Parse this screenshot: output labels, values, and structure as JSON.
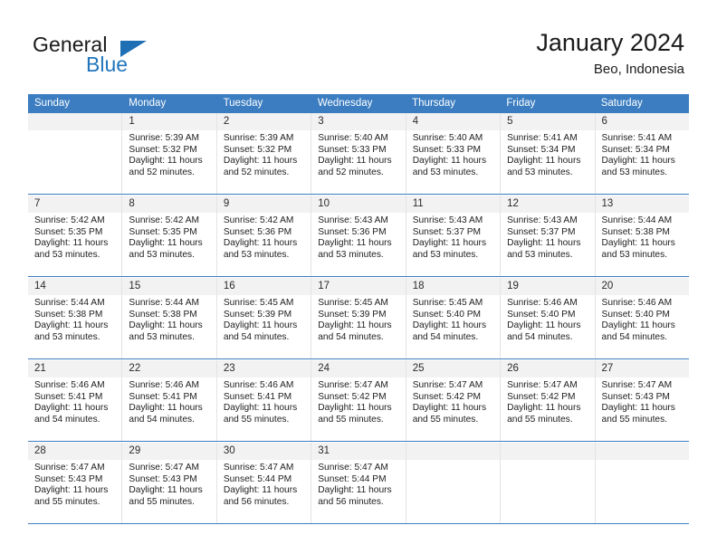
{
  "brand": {
    "name_part1": "General",
    "name_part2": "Blue",
    "triangle_icon": "triangle-icon",
    "accent_color": "#2176bd"
  },
  "header": {
    "title": "January 2024",
    "location": "Beo, Indonesia"
  },
  "calendar": {
    "header_color": "#3b7dc0",
    "daynum_bg": "#f2f2f2",
    "weekday_headers": [
      "Sunday",
      "Monday",
      "Tuesday",
      "Wednesday",
      "Thursday",
      "Friday",
      "Saturday"
    ],
    "weeks": [
      [
        {
          "day": "",
          "sunrise": "",
          "sunset": "",
          "daylight1": "",
          "daylight2": "",
          "empty": true
        },
        {
          "day": "1",
          "sunrise": "Sunrise: 5:39 AM",
          "sunset": "Sunset: 5:32 PM",
          "daylight1": "Daylight: 11 hours",
          "daylight2": "and 52 minutes.",
          "empty": false
        },
        {
          "day": "2",
          "sunrise": "Sunrise: 5:39 AM",
          "sunset": "Sunset: 5:32 PM",
          "daylight1": "Daylight: 11 hours",
          "daylight2": "and 52 minutes.",
          "empty": false
        },
        {
          "day": "3",
          "sunrise": "Sunrise: 5:40 AM",
          "sunset": "Sunset: 5:33 PM",
          "daylight1": "Daylight: 11 hours",
          "daylight2": "and 52 minutes.",
          "empty": false
        },
        {
          "day": "4",
          "sunrise": "Sunrise: 5:40 AM",
          "sunset": "Sunset: 5:33 PM",
          "daylight1": "Daylight: 11 hours",
          "daylight2": "and 53 minutes.",
          "empty": false
        },
        {
          "day": "5",
          "sunrise": "Sunrise: 5:41 AM",
          "sunset": "Sunset: 5:34 PM",
          "daylight1": "Daylight: 11 hours",
          "daylight2": "and 53 minutes.",
          "empty": false
        },
        {
          "day": "6",
          "sunrise": "Sunrise: 5:41 AM",
          "sunset": "Sunset: 5:34 PM",
          "daylight1": "Daylight: 11 hours",
          "daylight2": "and 53 minutes.",
          "empty": false
        }
      ],
      [
        {
          "day": "7",
          "sunrise": "Sunrise: 5:42 AM",
          "sunset": "Sunset: 5:35 PM",
          "daylight1": "Daylight: 11 hours",
          "daylight2": "and 53 minutes.",
          "empty": false
        },
        {
          "day": "8",
          "sunrise": "Sunrise: 5:42 AM",
          "sunset": "Sunset: 5:35 PM",
          "daylight1": "Daylight: 11 hours",
          "daylight2": "and 53 minutes.",
          "empty": false
        },
        {
          "day": "9",
          "sunrise": "Sunrise: 5:42 AM",
          "sunset": "Sunset: 5:36 PM",
          "daylight1": "Daylight: 11 hours",
          "daylight2": "and 53 minutes.",
          "empty": false
        },
        {
          "day": "10",
          "sunrise": "Sunrise: 5:43 AM",
          "sunset": "Sunset: 5:36 PM",
          "daylight1": "Daylight: 11 hours",
          "daylight2": "and 53 minutes.",
          "empty": false
        },
        {
          "day": "11",
          "sunrise": "Sunrise: 5:43 AM",
          "sunset": "Sunset: 5:37 PM",
          "daylight1": "Daylight: 11 hours",
          "daylight2": "and 53 minutes.",
          "empty": false
        },
        {
          "day": "12",
          "sunrise": "Sunrise: 5:43 AM",
          "sunset": "Sunset: 5:37 PM",
          "daylight1": "Daylight: 11 hours",
          "daylight2": "and 53 minutes.",
          "empty": false
        },
        {
          "day": "13",
          "sunrise": "Sunrise: 5:44 AM",
          "sunset": "Sunset: 5:38 PM",
          "daylight1": "Daylight: 11 hours",
          "daylight2": "and 53 minutes.",
          "empty": false
        }
      ],
      [
        {
          "day": "14",
          "sunrise": "Sunrise: 5:44 AM",
          "sunset": "Sunset: 5:38 PM",
          "daylight1": "Daylight: 11 hours",
          "daylight2": "and 53 minutes.",
          "empty": false
        },
        {
          "day": "15",
          "sunrise": "Sunrise: 5:44 AM",
          "sunset": "Sunset: 5:38 PM",
          "daylight1": "Daylight: 11 hours",
          "daylight2": "and 53 minutes.",
          "empty": false
        },
        {
          "day": "16",
          "sunrise": "Sunrise: 5:45 AM",
          "sunset": "Sunset: 5:39 PM",
          "daylight1": "Daylight: 11 hours",
          "daylight2": "and 54 minutes.",
          "empty": false
        },
        {
          "day": "17",
          "sunrise": "Sunrise: 5:45 AM",
          "sunset": "Sunset: 5:39 PM",
          "daylight1": "Daylight: 11 hours",
          "daylight2": "and 54 minutes.",
          "empty": false
        },
        {
          "day": "18",
          "sunrise": "Sunrise: 5:45 AM",
          "sunset": "Sunset: 5:40 PM",
          "daylight1": "Daylight: 11 hours",
          "daylight2": "and 54 minutes.",
          "empty": false
        },
        {
          "day": "19",
          "sunrise": "Sunrise: 5:46 AM",
          "sunset": "Sunset: 5:40 PM",
          "daylight1": "Daylight: 11 hours",
          "daylight2": "and 54 minutes.",
          "empty": false
        },
        {
          "day": "20",
          "sunrise": "Sunrise: 5:46 AM",
          "sunset": "Sunset: 5:40 PM",
          "daylight1": "Daylight: 11 hours",
          "daylight2": "and 54 minutes.",
          "empty": false
        }
      ],
      [
        {
          "day": "21",
          "sunrise": "Sunrise: 5:46 AM",
          "sunset": "Sunset: 5:41 PM",
          "daylight1": "Daylight: 11 hours",
          "daylight2": "and 54 minutes.",
          "empty": false
        },
        {
          "day": "22",
          "sunrise": "Sunrise: 5:46 AM",
          "sunset": "Sunset: 5:41 PM",
          "daylight1": "Daylight: 11 hours",
          "daylight2": "and 54 minutes.",
          "empty": false
        },
        {
          "day": "23",
          "sunrise": "Sunrise: 5:46 AM",
          "sunset": "Sunset: 5:41 PM",
          "daylight1": "Daylight: 11 hours",
          "daylight2": "and 55 minutes.",
          "empty": false
        },
        {
          "day": "24",
          "sunrise": "Sunrise: 5:47 AM",
          "sunset": "Sunset: 5:42 PM",
          "daylight1": "Daylight: 11 hours",
          "daylight2": "and 55 minutes.",
          "empty": false
        },
        {
          "day": "25",
          "sunrise": "Sunrise: 5:47 AM",
          "sunset": "Sunset: 5:42 PM",
          "daylight1": "Daylight: 11 hours",
          "daylight2": "and 55 minutes.",
          "empty": false
        },
        {
          "day": "26",
          "sunrise": "Sunrise: 5:47 AM",
          "sunset": "Sunset: 5:42 PM",
          "daylight1": "Daylight: 11 hours",
          "daylight2": "and 55 minutes.",
          "empty": false
        },
        {
          "day": "27",
          "sunrise": "Sunrise: 5:47 AM",
          "sunset": "Sunset: 5:43 PM",
          "daylight1": "Daylight: 11 hours",
          "daylight2": "and 55 minutes.",
          "empty": false
        }
      ],
      [
        {
          "day": "28",
          "sunrise": "Sunrise: 5:47 AM",
          "sunset": "Sunset: 5:43 PM",
          "daylight1": "Daylight: 11 hours",
          "daylight2": "and 55 minutes.",
          "empty": false
        },
        {
          "day": "29",
          "sunrise": "Sunrise: 5:47 AM",
          "sunset": "Sunset: 5:43 PM",
          "daylight1": "Daylight: 11 hours",
          "daylight2": "and 55 minutes.",
          "empty": false
        },
        {
          "day": "30",
          "sunrise": "Sunrise: 5:47 AM",
          "sunset": "Sunset: 5:44 PM",
          "daylight1": "Daylight: 11 hours",
          "daylight2": "and 56 minutes.",
          "empty": false
        },
        {
          "day": "31",
          "sunrise": "Sunrise: 5:47 AM",
          "sunset": "Sunset: 5:44 PM",
          "daylight1": "Daylight: 11 hours",
          "daylight2": "and 56 minutes.",
          "empty": false
        },
        {
          "day": "",
          "sunrise": "",
          "sunset": "",
          "daylight1": "",
          "daylight2": "",
          "empty": true
        },
        {
          "day": "",
          "sunrise": "",
          "sunset": "",
          "daylight1": "",
          "daylight2": "",
          "empty": true
        },
        {
          "day": "",
          "sunrise": "",
          "sunset": "",
          "daylight1": "",
          "daylight2": "",
          "empty": true
        }
      ]
    ]
  }
}
